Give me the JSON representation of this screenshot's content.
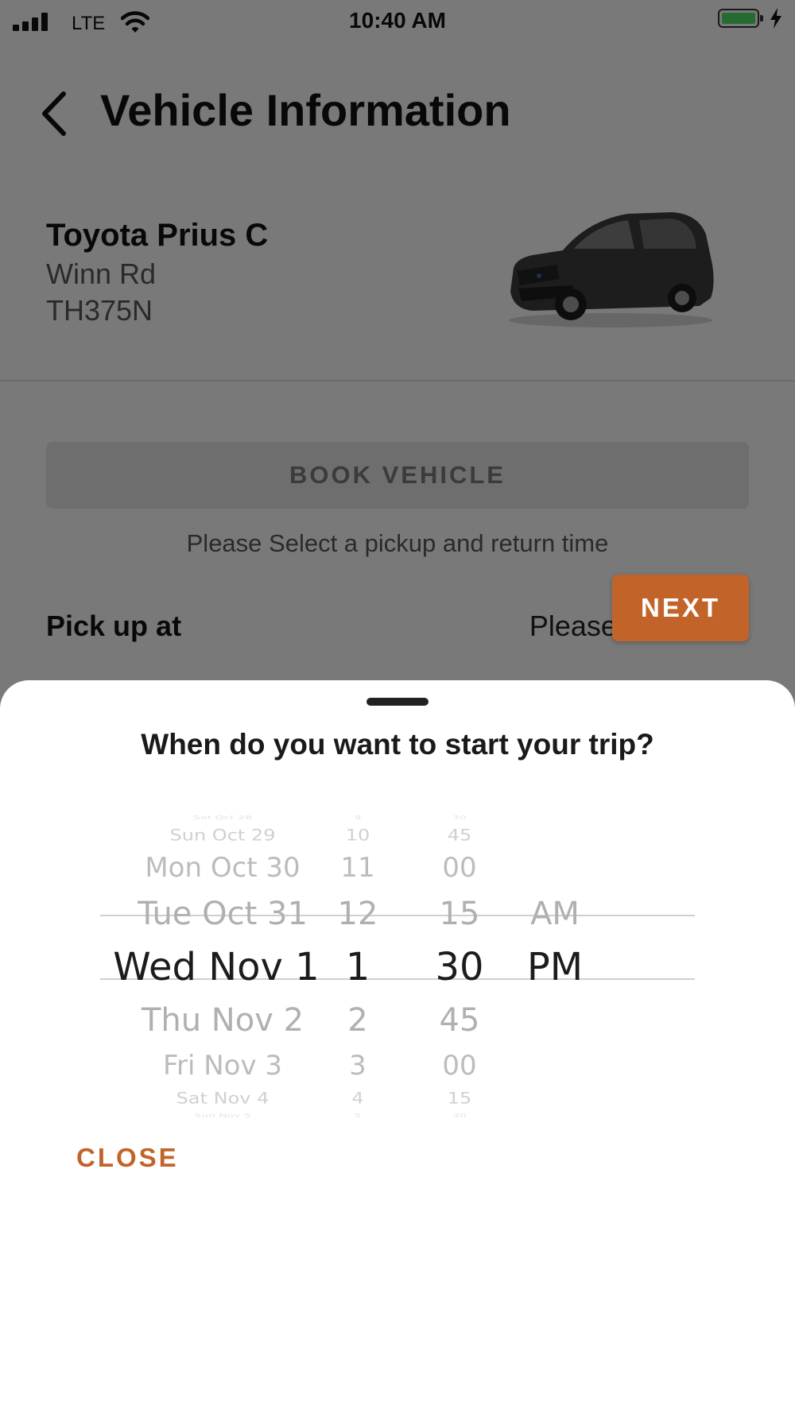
{
  "status_bar": {
    "network": "LTE",
    "time": "10:40 AM",
    "battery_color": "#4cd964"
  },
  "header": {
    "back_icon": "chevron-left-icon",
    "title": "Vehicle Information"
  },
  "vehicle": {
    "name": "Toyota Prius C",
    "location": "Winn Rd",
    "plate": "TH375N",
    "image": "car-image"
  },
  "booking": {
    "book_button": "BOOK VEHICLE",
    "helper_text": "Please Select a pickup and return time",
    "pickup_label": "Pick up at",
    "pickup_value": "Please set a time"
  },
  "sheet": {
    "title": "When do you want to start your trip?",
    "picker": {
      "days": [
        "Sat Oct 28",
        "Sun Oct 29",
        "Mon Oct 30",
        "Tue Oct 31",
        "Wed Nov 1",
        "Thu Nov 2",
        "Fri Nov 3",
        "Sat Nov 4",
        "Sun Nov 5"
      ],
      "hours": [
        "9",
        "10",
        "11",
        "12",
        "1",
        "2",
        "3",
        "4",
        "5"
      ],
      "minutes": [
        "30",
        "45",
        "00",
        "15",
        "30",
        "45",
        "00",
        "15",
        "30"
      ],
      "periods": [
        "",
        "",
        "",
        "AM",
        "PM",
        "",
        "",
        "",
        ""
      ],
      "selected": {
        "day": "Wed Nov 1",
        "hour": "1",
        "minute": "30",
        "period": "PM"
      }
    },
    "close_label": "CLOSE",
    "next_label": "NEXT",
    "accent_color": "#c2642a"
  }
}
